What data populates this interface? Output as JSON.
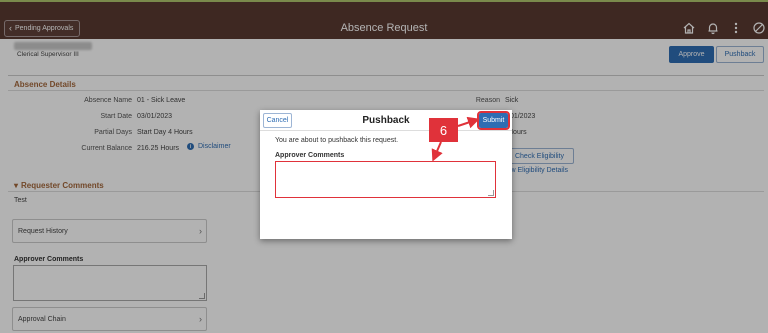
{
  "header": {
    "back_label": "Pending Approvals",
    "title": "Absence Request"
  },
  "employee": {
    "title": "Clerical Supervisor III"
  },
  "actions": {
    "approve": "Approve",
    "pushback": "Pushback"
  },
  "details": {
    "section_title": "Absence Details",
    "absence_name_label": "Absence Name",
    "absence_name_value": "01 - Sick Leave",
    "start_date_label": "Start Date",
    "start_date_value": "03/01/2023",
    "partial_days_label": "Partial Days",
    "partial_days_value": "Start Day 4 Hours",
    "balance_label": "Current Balance",
    "balance_value": "216.25 Hours",
    "disclaimer": "Disclaimer",
    "reason_label": "Reason",
    "reason_value": "Sick",
    "end_date_partial": "/01/2023",
    "hours_partial": "Hours",
    "check_eligibility": "Check Eligibility",
    "view_eligibility": "iew Eligibility Details"
  },
  "requester": {
    "section_title": "Requester Comments",
    "text": "Test"
  },
  "panels": {
    "request_history": "Request History",
    "approver_comments_label": "Approver Comments",
    "approval_chain": "Approval Chain"
  },
  "modal": {
    "cancel": "Cancel",
    "title": "Pushback",
    "submit": "Submit",
    "message": "You are about to pushback this request.",
    "comments_label": "Approver Comments"
  },
  "annotation": {
    "step": "6",
    "color": "#e0323a"
  }
}
